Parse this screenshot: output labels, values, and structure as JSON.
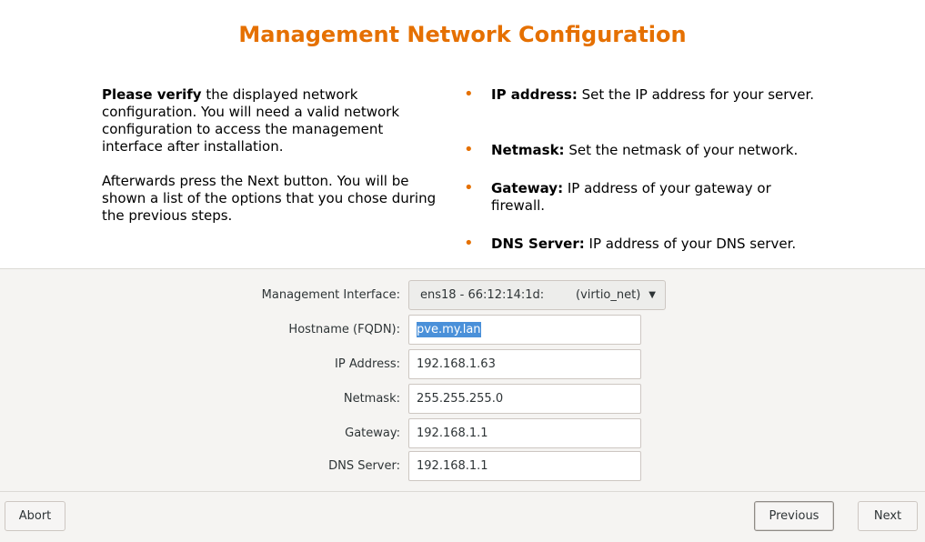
{
  "title": "Management Network Configuration",
  "intro": {
    "bold1": "Please verify",
    "text1": " the displayed network configuration. You will need a valid network configuration to access the management interface after installation.",
    "text2": "Afterwards press the Next button. You will be shown a list of the options that you chose during the previous steps."
  },
  "bullets": [
    {
      "term": "IP address:",
      "desc": " Set the IP address for your server."
    },
    {
      "term": "Netmask:",
      "desc": " Set the netmask of your network."
    },
    {
      "term": "Gateway:",
      "desc": " IP address of your gateway or firewall."
    },
    {
      "term": "DNS Server:",
      "desc": " IP address of your DNS server."
    }
  ],
  "form": {
    "interface_label": "Management Interface:",
    "interface_value": "ens18 - 66:12:14:1d:",
    "interface_driver": "(virtio_net)",
    "hostname_label": "Hostname (FQDN):",
    "hostname_value": "pve.my.lan",
    "ip_label": "IP Address:",
    "ip_value": "192.168.1.63",
    "netmask_label": "Netmask:",
    "netmask_value": "255.255.255.0",
    "gateway_label": "Gateway:",
    "gateway_value": "192.168.1.1",
    "dns_label": "DNS Server:",
    "dns_value": "192.168.1.1"
  },
  "buttons": {
    "abort": "Abort",
    "previous": "Previous",
    "next": "Next"
  },
  "colors": {
    "accent": "#e57000",
    "selection": "#4a90d9"
  }
}
